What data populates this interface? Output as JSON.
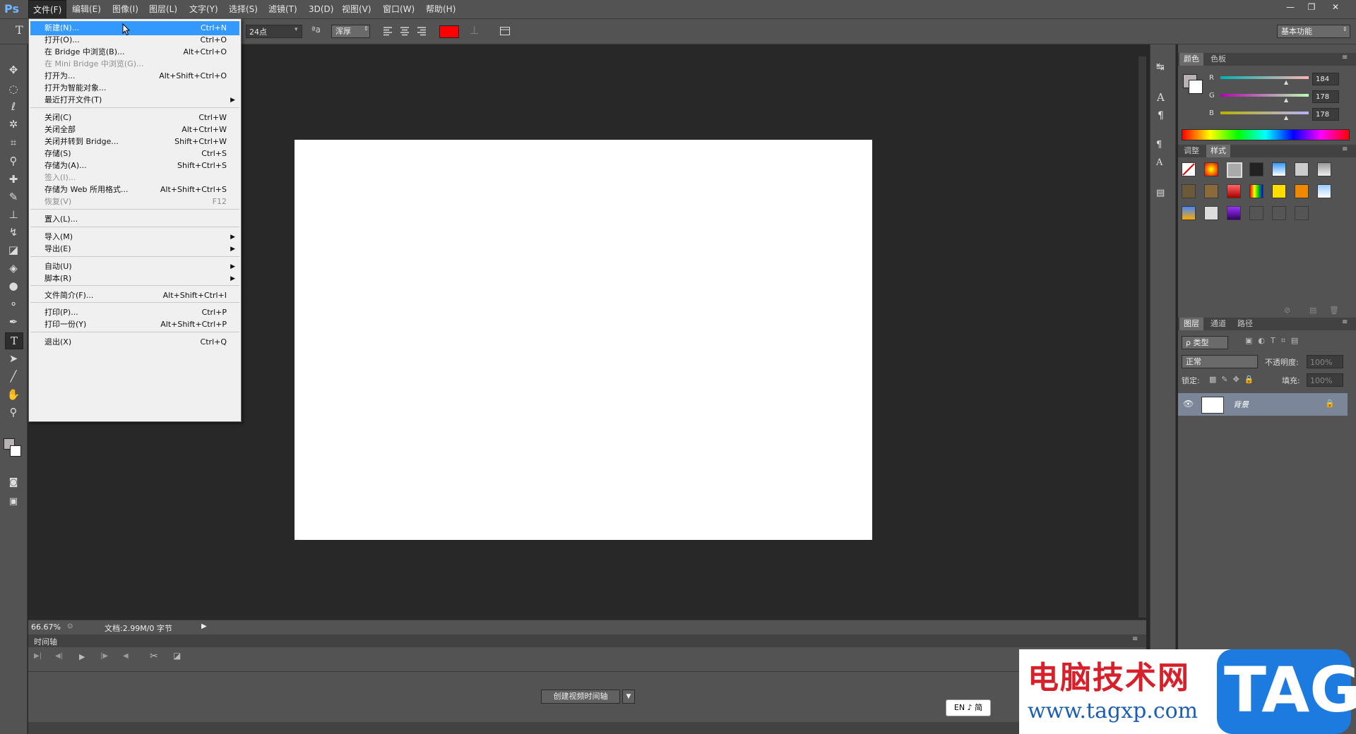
{
  "app": {
    "logo": "Ps"
  },
  "menubar": {
    "items": [
      "文件(F)",
      "编辑(E)",
      "图像(I)",
      "图层(L)",
      "文字(Y)",
      "选择(S)",
      "滤镜(T)",
      "3D(D)",
      "视图(V)",
      "窗口(W)",
      "帮助(H)"
    ],
    "active_index": 0
  },
  "window_controls": {
    "minimize": "—",
    "restore": "❐",
    "close": "✕"
  },
  "options_bar": {
    "tool_glyph": "T",
    "font_size": "24点",
    "aa_icon": "ªa",
    "aa_mode": "浑厚",
    "text_color": "#ff0000",
    "workspace": "基本功能"
  },
  "file_menu": {
    "items": [
      {
        "label": "新建(N)...",
        "shortcut": "Ctrl+N",
        "state": "highlighted"
      },
      {
        "label": "打开(O)...",
        "shortcut": "Ctrl+O"
      },
      {
        "label": "在 Bridge 中浏览(B)...",
        "shortcut": "Alt+Ctrl+O"
      },
      {
        "label": "在 Mini Bridge 中浏览(G)...",
        "shortcut": "",
        "state": "disabled"
      },
      {
        "label": "打开为...",
        "shortcut": "Alt+Shift+Ctrl+O"
      },
      {
        "label": "打开为智能对象...",
        "shortcut": ""
      },
      {
        "label": "最近打开文件(T)",
        "shortcut": "",
        "submenu": true
      },
      {
        "label": "关闭(C)",
        "shortcut": "Ctrl+W"
      },
      {
        "label": "关闭全部",
        "shortcut": "Alt+Ctrl+W"
      },
      {
        "label": "关闭并转到 Bridge...",
        "shortcut": "Shift+Ctrl+W"
      },
      {
        "label": "存储(S)",
        "shortcut": "Ctrl+S"
      },
      {
        "label": "存储为(A)...",
        "shortcut": "Shift+Ctrl+S"
      },
      {
        "label": "签入(I)...",
        "shortcut": "",
        "state": "disabled"
      },
      {
        "label": "存储为 Web 所用格式...",
        "shortcut": "Alt+Shift+Ctrl+S"
      },
      {
        "label": "恢复(V)",
        "shortcut": "F12",
        "state": "disabled"
      },
      {
        "label": "置入(L)...",
        "shortcut": ""
      },
      {
        "label": "导入(M)",
        "shortcut": "",
        "submenu": true
      },
      {
        "label": "导出(E)",
        "shortcut": "",
        "submenu": true
      },
      {
        "label": "自动(U)",
        "shortcut": "",
        "submenu": true
      },
      {
        "label": "脚本(R)",
        "shortcut": "",
        "submenu": true
      },
      {
        "label": "文件简介(F)...",
        "shortcut": "Alt+Shift+Ctrl+I"
      },
      {
        "label": "打印(P)...",
        "shortcut": "Ctrl+P"
      },
      {
        "label": "打印一份(Y)",
        "shortcut": "Alt+Shift+Ctrl+P"
      },
      {
        "label": "退出(X)",
        "shortcut": "Ctrl+Q"
      }
    ],
    "submenu_arrow": "▶"
  },
  "statusbar": {
    "zoom": "66.67%",
    "doc_info": "文档:2.99M/0 字节"
  },
  "timeline": {
    "title": "时间轴",
    "create_button": "创建视频时间轴"
  },
  "color_panel": {
    "tabs": [
      "颜色",
      "色板"
    ],
    "channels": [
      {
        "name": "R",
        "value": "184"
      },
      {
        "name": "G",
        "value": "178"
      },
      {
        "name": "B",
        "value": "178"
      }
    ],
    "foreground": "#b8b2b2"
  },
  "styles_panel": {
    "tabs": [
      "调整",
      "样式"
    ]
  },
  "layers_panel": {
    "tabs": [
      "图层",
      "通道",
      "路径"
    ],
    "filter": "ρ 类型",
    "blend_mode": "正常",
    "opacity_label": "不透明度:",
    "opacity_value": "100%",
    "lock_label": "锁定:",
    "fill_label": "填充:",
    "fill_value": "100%",
    "layer_name": "背景"
  },
  "ime": {
    "text": "EN ♪ 简"
  },
  "watermark": {
    "site_cn": "电脑技术网",
    "url": "www.tagxp.com",
    "tag": "TAG"
  }
}
